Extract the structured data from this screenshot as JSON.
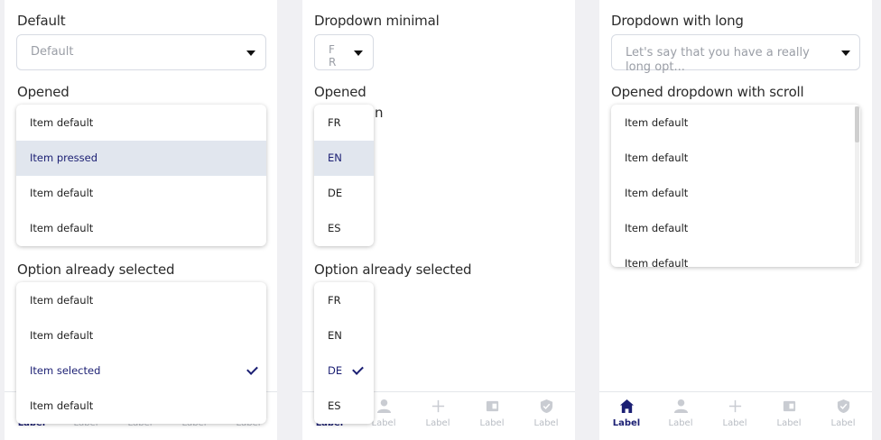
{
  "panel1": {
    "default_label": "Default",
    "default_value": "Default",
    "opened_label": "Opened",
    "opened_items": [
      "Item default",
      "Item pressed",
      "Item default",
      "Item default"
    ],
    "selected_label": "Option already selected",
    "selected_items": [
      "Item default",
      "Item default",
      "Item selected",
      "Item default"
    ]
  },
  "panel2": {
    "minimal_label": "Dropdown minimal",
    "minimal_value": "F\nR",
    "opened_label": "Opened",
    "opened_partial": "n",
    "opened_items": [
      "FR",
      "EN",
      "DE",
      "ES"
    ],
    "selected_label": "Option already selected",
    "selected_items": [
      "FR",
      "EN",
      "DE",
      "ES"
    ]
  },
  "panel3": {
    "long_label": "Dropdown with long",
    "long_value": "Let's say that you have a really long opt...",
    "scroll_label": "Opened dropdown with scroll",
    "scroll_items": [
      "Item default",
      "Item default",
      "Item default",
      "Item default",
      "Item default"
    ]
  },
  "tabbar": {
    "labels": [
      "Label",
      "Label",
      "Label",
      "Label",
      "Label"
    ],
    "icons": [
      "home-icon",
      "person-icon",
      "plus-icon",
      "wallet-icon",
      "shield-icon"
    ]
  },
  "colors": {
    "accent": "#1b1f73",
    "pressed_bg": "#e1e6ee",
    "muted": "#b8bcc3"
  }
}
